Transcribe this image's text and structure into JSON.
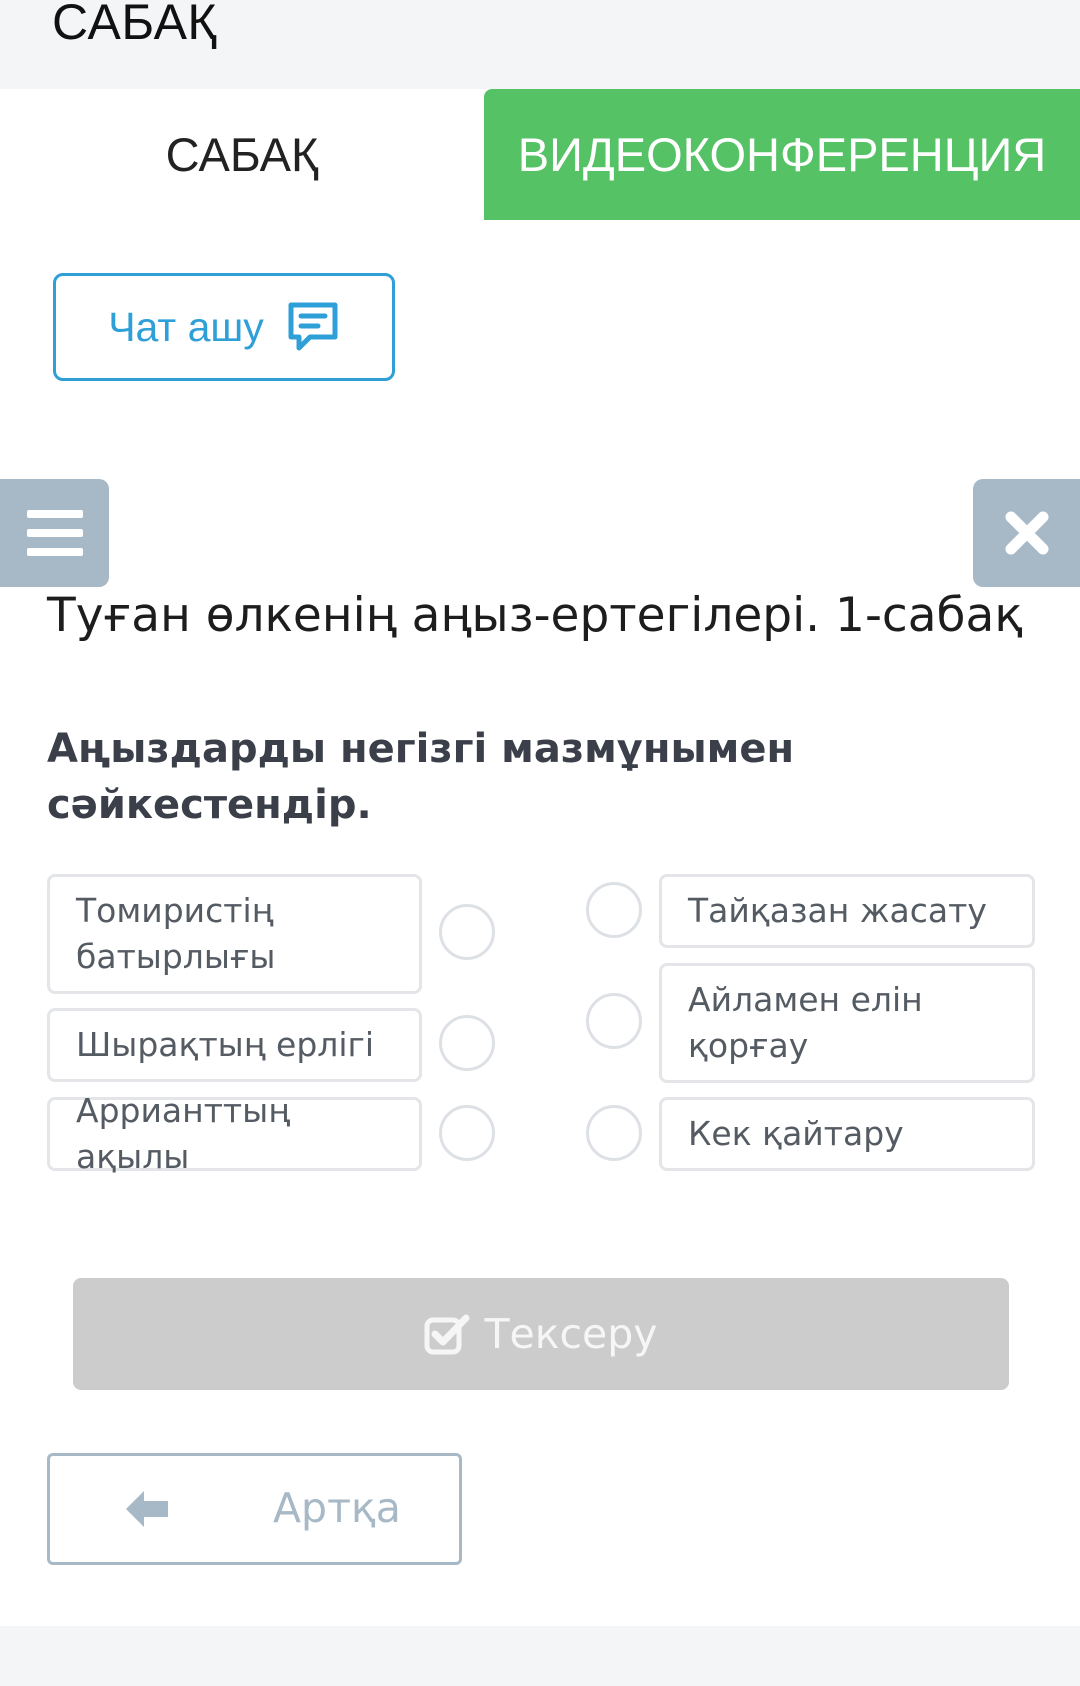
{
  "header": {
    "title": "САБАҚ"
  },
  "tabs": {
    "lesson": "САБАҚ",
    "video": "ВИДЕОКОНФЕРЕНЦИЯ"
  },
  "chat": {
    "label": "Чат ашу",
    "icon": "chat-bubble-icon"
  },
  "controls": {
    "menu_icon": "hamburger-menu-icon",
    "close_icon": "close-icon"
  },
  "lesson": {
    "title": "Туған өлкенің аңыз-ертегілері. 1-сабақ"
  },
  "question": {
    "text": "Аңыздарды негізгі мазмұнымен сәйкестендір."
  },
  "matching": {
    "left": [
      "Томиристің батырлығы",
      "Шырақтың ерлігі",
      "Арриант­тың ақылы"
    ],
    "right": [
      "Тайқазан жасату",
      "Айламен елін қорғау",
      "Кек қайтару"
    ]
  },
  "actions": {
    "check_label": "Тексеру",
    "check_icon": "checkbox-checked-icon",
    "back_label": "Артқа",
    "back_icon": "arrow-left-icon"
  },
  "colors": {
    "green_tab": "#55c266",
    "chat_blue": "#2f9fd8",
    "slate": "#a7b9c7",
    "disabled_gray": "#cccccc"
  }
}
